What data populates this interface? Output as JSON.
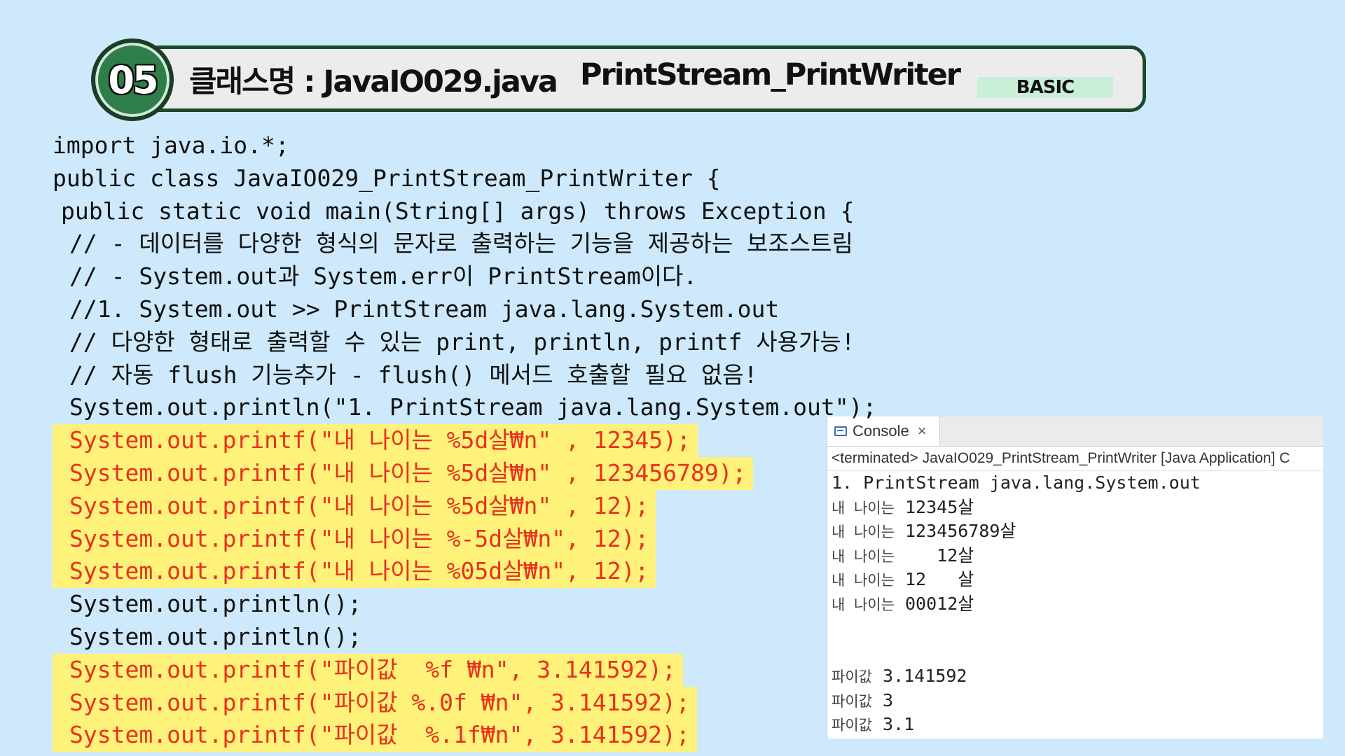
{
  "header": {
    "number": "05",
    "class_label": "클래스명 : JavaIO029.java",
    "topic": "PrintStream_PrintWriter",
    "level": "BASIC"
  },
  "code_lines": [
    {
      "text": "import java.io.*;",
      "indent": 0,
      "hl": false
    },
    {
      "text": "public class JavaIO029_PrintStream_PrintWriter {",
      "indent": 0,
      "hl": false
    },
    {
      "text": "public static void main(String[] args) throws Exception {",
      "indent": 1,
      "hl": false
    },
    {
      "text": "// - 데이터를 다양한 형식의 문자로 출력하는 기능을 제공하는 보조스트림",
      "indent": 2,
      "hl": false
    },
    {
      "text": "// - System.out과 System.err이 PrintStream이다.",
      "indent": 2,
      "hl": false
    },
    {
      "text": "//1. System.out >> PrintStream java.lang.System.out",
      "indent": 2,
      "hl": false
    },
    {
      "text": "// 다양한 형태로 출력할 수 있는 print, println, printf 사용가능!",
      "indent": 2,
      "hl": false
    },
    {
      "text": "// 자동 flush 기능추가 - flush() 메서드 호출할 필요 없음!",
      "indent": 2,
      "hl": false
    },
    {
      "text": "System.out.println(\"1. PrintStream java.lang.System.out\");",
      "indent": 2,
      "hl": false
    },
    {
      "text": "System.out.printf(\"내 나이는 %5d살₩n\" , 12345);",
      "indent": 2,
      "hl": true
    },
    {
      "text": "System.out.printf(\"내 나이는 %5d살₩n\" , 123456789);",
      "indent": 2,
      "hl": true
    },
    {
      "text": "System.out.printf(\"내 나이는 %5d살₩n\" , 12);",
      "indent": 2,
      "hl": true
    },
    {
      "text": "System.out.printf(\"내 나이는 %-5d살₩n\", 12);",
      "indent": 2,
      "hl": true
    },
    {
      "text": "System.out.printf(\"내 나이는 %05d살₩n\", 12);",
      "indent": 2,
      "hl": true
    },
    {
      "text": "System.out.println();",
      "indent": 2,
      "hl": false
    },
    {
      "text": "System.out.println();",
      "indent": 2,
      "hl": false
    },
    {
      "text": "System.out.printf(\"파이값  %f ₩n\", 3.141592);",
      "indent": 2,
      "hl": true
    },
    {
      "text": "System.out.printf(\"파이값 %.0f ₩n\", 3.141592);",
      "indent": 2,
      "hl": true
    },
    {
      "text": "System.out.printf(\"파이값  %.1f₩n\", 3.141592);",
      "indent": 2,
      "hl": true
    }
  ],
  "console": {
    "tab_label": "Console",
    "status": "<terminated> JavaIO029_PrintStream_PrintWriter [Java Application] C",
    "lines": [
      {
        "label": "",
        "value": "1. PrintStream java.lang.System.out"
      },
      {
        "label": "내 나이는",
        "value": " 12345살"
      },
      {
        "label": "내 나이는",
        "value": " 123456789살"
      },
      {
        "label": "내 나이는",
        "value": "    12살"
      },
      {
        "label": "내 나이는",
        "value": " 12   살"
      },
      {
        "label": "내 나이는",
        "value": " 00012살"
      },
      {
        "label": "",
        "value": ""
      },
      {
        "label": "",
        "value": ""
      },
      {
        "label": "파이값",
        "value": " 3.141592"
      },
      {
        "label": "파이값",
        "value": " 3"
      },
      {
        "label": "파이값",
        "value": " 3.1"
      }
    ]
  },
  "colors": {
    "background": "#cde9fb",
    "highlight": "#fff27a",
    "highlight_text": "#e8311f",
    "badge": "#2f7d4a"
  }
}
